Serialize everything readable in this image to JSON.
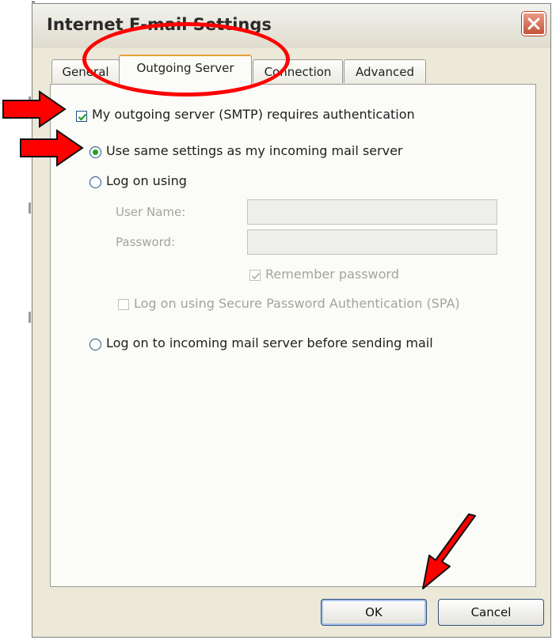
{
  "dialog": {
    "title": "Internet E-mail Settings",
    "close_icon": "close-icon"
  },
  "tabs": [
    {
      "label": "General",
      "active": false
    },
    {
      "label": "Outgoing Server",
      "active": true
    },
    {
      "label": "Connection",
      "active": false
    },
    {
      "label": "Advanced",
      "active": false
    }
  ],
  "outgoing": {
    "auth_checkbox_label": "My outgoing server (SMTP) requires authentication",
    "auth_checked": true,
    "same_settings_label": "Use same settings as my incoming mail server",
    "same_settings_selected": true,
    "log_on_using_label": "Log on using",
    "user_name_label": "User Name:",
    "user_name_value": "",
    "password_label": "Password:",
    "password_value": "",
    "remember_password_label": "Remember password",
    "remember_password_checked": true,
    "spa_label": "Log on using Secure Password Authentication (SPA)",
    "spa_checked": false,
    "log_on_incoming_label": "Log on to incoming mail server before sending mail"
  },
  "buttons": {
    "ok_label": "OK",
    "cancel_label": "Cancel"
  },
  "colors": {
    "annotation": "#ff0000",
    "dialog_bg": "#ece9d8",
    "check": "#21a121"
  }
}
